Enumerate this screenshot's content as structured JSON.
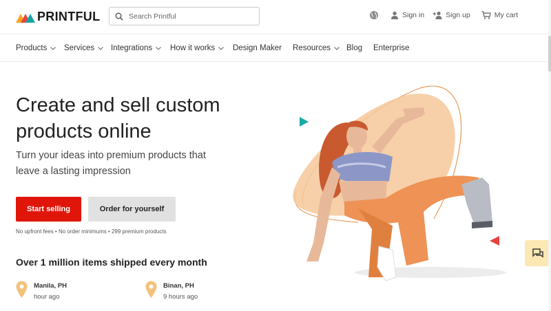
{
  "brand": {
    "name": "PRINTFUL"
  },
  "search": {
    "placeholder": "Search Printful"
  },
  "header": {
    "globe_icon": "globe-icon",
    "sign_in": "Sign in",
    "sign_up": "Sign up",
    "cart": "My cart"
  },
  "nav": {
    "items": [
      {
        "label": "Products",
        "dropdown": true
      },
      {
        "label": "Services",
        "dropdown": true
      },
      {
        "label": "Integrations",
        "dropdown": true
      },
      {
        "label": "How it works",
        "dropdown": true
      },
      {
        "label": "Design Maker",
        "dropdown": false
      },
      {
        "label": "Resources",
        "dropdown": true
      },
      {
        "label": "Blog",
        "dropdown": false
      },
      {
        "label": "Enterprise",
        "dropdown": false
      }
    ]
  },
  "hero": {
    "title_line1": "Create and sell custom",
    "title_line2": "products online",
    "subtitle_line1": "Turn your ideas into premium products that",
    "subtitle_line2": "leave a lasting impression",
    "primary_cta": "Start selling",
    "secondary_cta": "Order for yourself",
    "note": "No upfront fees • No order minimums • 299 premium products"
  },
  "shipping": {
    "heading": "Over 1 million items shipped every month",
    "locations": [
      {
        "city": "Manila, PH",
        "when": "hour ago"
      },
      {
        "city": "Binan, PH",
        "when": "9 hours ago"
      }
    ]
  },
  "colors": {
    "brand_red": "#e1160b",
    "secondary_gray": "#e1e1e1",
    "accent_teal": "#19a9a6",
    "accent_orange": "#f6c89a",
    "chat_bg": "#fbe8b2"
  }
}
